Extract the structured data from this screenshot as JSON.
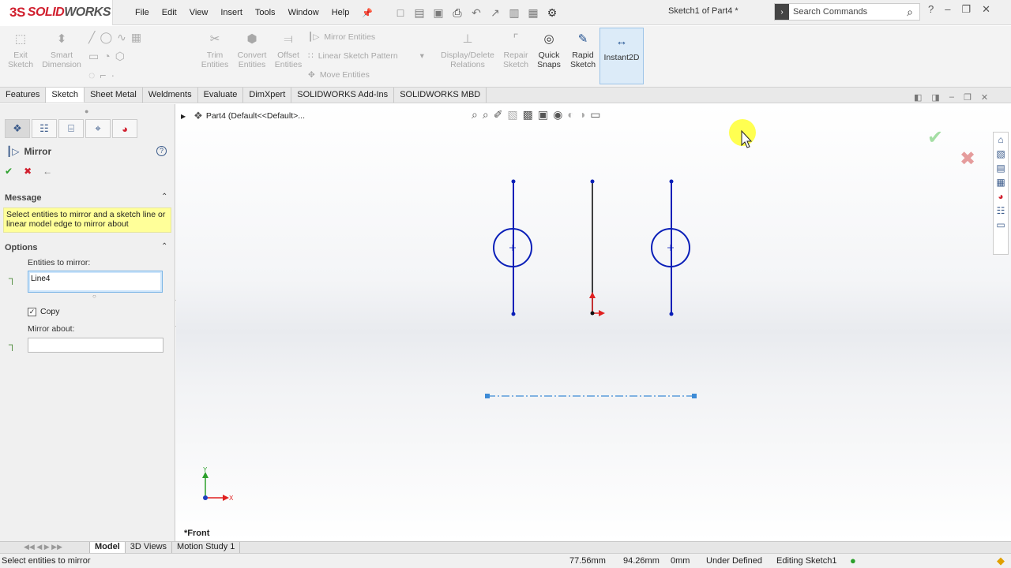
{
  "app": {
    "name": "SOLIDWORKS",
    "ds": "3S",
    "solid": "SOLID",
    "works": "WORKS"
  },
  "menu": [
    "File",
    "Edit",
    "View",
    "Insert",
    "Tools",
    "Window",
    "Help"
  ],
  "document_title": "Sketch1 of Part4 *",
  "search": {
    "placeholder": "Search Commands"
  },
  "toolbar": {
    "exit_sketch": "Exit Sketch",
    "smart_dimension": "Smart Dimension",
    "trim_entities": "Trim Entities",
    "convert_entities": "Convert Entities",
    "offset_entities": "Offset Entities",
    "mirror_entities": "Mirror Entities",
    "linear_sketch_pattern": "Linear Sketch Pattern",
    "move_entities": "Move Entities",
    "display_delete_relations": "Display/Delete Relations",
    "repair_sketch": "Repair Sketch",
    "quick_snaps": "Quick Snaps",
    "rapid_sketch": "Rapid Sketch",
    "instant2d": "Instant2D"
  },
  "tabs": [
    "Features",
    "Sketch",
    "Sheet Metal",
    "Weldments",
    "Evaluate",
    "DimXpert",
    "SOLIDWORKS Add-Ins",
    "SOLIDWORKS MBD"
  ],
  "active_tab": "Sketch",
  "property_manager": {
    "title": "Mirror",
    "message_header": "Message",
    "message": "Select entities to mirror and a sketch line or linear model edge to mirror about",
    "options_header": "Options",
    "entities_label": "Entities to mirror:",
    "entities_value": "Line4",
    "copy_label": "Copy",
    "copy_checked": true,
    "mirror_about_label": "Mirror about:"
  },
  "tree": {
    "part": "Part4  (Default<<Default>..."
  },
  "view_label": "*Front",
  "bottom_tabs": [
    "Model",
    "3D Views",
    "Motion Study 1"
  ],
  "status": {
    "message": "Select entities to mirror",
    "x": "77.56mm",
    "y": "94.26mm",
    "z": "0mm",
    "definition": "Under Defined",
    "editing": "Editing Sketch1"
  },
  "axis": {
    "x": "X",
    "y": "Y"
  },
  "colors": {
    "sketch": "#0a1fb8",
    "accent_red": "#d1202f",
    "message_bg": "#ffff99"
  },
  "icons": [
    "search-icon",
    "mirror-icon",
    "ok-icon",
    "cancel-icon",
    "pin-icon",
    "help-icon",
    "checkbox-icon"
  ]
}
